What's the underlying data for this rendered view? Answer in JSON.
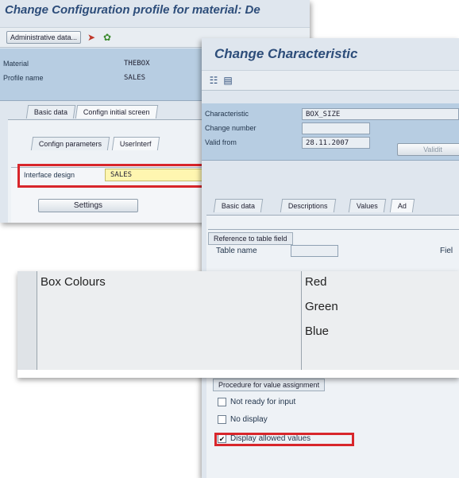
{
  "config_profile": {
    "title": "Change Configuration profile for material: De",
    "toolbar": {
      "admin_label": "Administrative data..."
    },
    "header": {
      "material_label": "Material",
      "material_value": "THEBOX",
      "profile_label": "Profile name",
      "profile_value": "SALES"
    },
    "tabs": [
      "Basic data",
      "Confign initial screen"
    ],
    "subtabs": [
      "Confign parameters",
      "UserInterf"
    ],
    "interface_design_label": "Interface design",
    "interface_design_value": "SALES",
    "settings_label": "Settings"
  },
  "characteristic": {
    "title": "Change Characteristic",
    "header": {
      "characteristic_label": "Characteristic",
      "characteristic_value": "BOX_SIZE",
      "change_number_label": "Change number",
      "change_number_value": "",
      "valid_from_label": "Valid from",
      "valid_from_value": "28.11.2007",
      "validity_button": "Validit"
    },
    "tabs": [
      "Basic data",
      "Descriptions",
      "Values",
      "Ad"
    ],
    "reference_group": "Reference to table field",
    "table_name_label": "Table name",
    "field_label": "Fiel",
    "procedure_group": "Procedure for value assignment",
    "options": [
      {
        "label": "Not ready for input",
        "checked": false
      },
      {
        "label": "No display",
        "checked": false
      },
      {
        "label": "Display allowed values",
        "checked": true
      }
    ]
  },
  "values_table": {
    "rows": [
      {
        "characteristic": "Box Colours",
        "value": "Red"
      },
      {
        "characteristic": "",
        "value": "Green"
      },
      {
        "characteristic": "",
        "value": "Blue"
      },
      {
        "characteristic": "",
        "value": ""
      }
    ]
  },
  "colors": {
    "highlight": "#d8262b",
    "header_band": "#b7cde2",
    "title_text": "#2d4d7a",
    "required_field": "#fff6b0"
  },
  "icons": [
    "object-links-icon",
    "classification-icon",
    "tree-icon",
    "table-icon",
    "checkmark-icon"
  ]
}
